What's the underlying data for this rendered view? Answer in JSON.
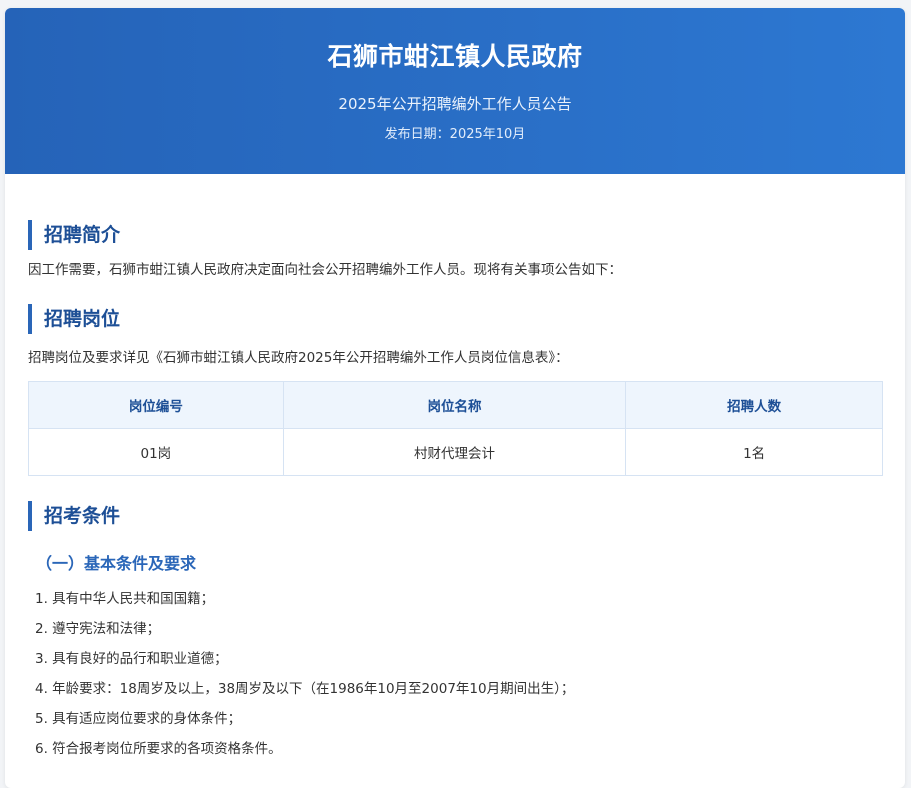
{
  "header": {
    "title": "石狮市蚶江镇人民政府",
    "subtitle": "2025年公开招聘编外工作人员公告",
    "date": "发布日期：2025年10月"
  },
  "intro": {
    "heading": "招聘简介",
    "text": "因工作需要，石狮市蚶江镇人民政府决定面向社会公开招聘编外工作人员。现将有关事项公告如下："
  },
  "positions": {
    "heading": "招聘岗位",
    "text": "招聘岗位及要求详见《石狮市蚶江镇人民政府2025年公开招聘编外工作人员岗位信息表》：",
    "columns": [
      "岗位编号",
      "岗位名称",
      "招聘人数"
    ],
    "rows": [
      [
        "01岗",
        "村财代理会计",
        "1名"
      ]
    ]
  },
  "conditions": {
    "heading": "招考条件",
    "subheading": "（一）基本条件及要求",
    "items": [
      "1. 具有中华人民共和国国籍；",
      "2. 遵守宪法和法律；",
      "3. 具有良好的品行和职业道德；",
      "4. 年龄要求：18周岁及以上，38周岁及以下（在1986年10月至2007年10月期间出生）；",
      "5. 具有适应岗位要求的身体条件；",
      "6. 符合报考岗位所要求的各项资格条件。"
    ]
  },
  "colors": {
    "banner_start": "#2563b8",
    "banner_end": "#2d78d2",
    "heading": "#1d4f96",
    "accent": "#2a66b8",
    "table_header_bg": "#eef5fd"
  }
}
